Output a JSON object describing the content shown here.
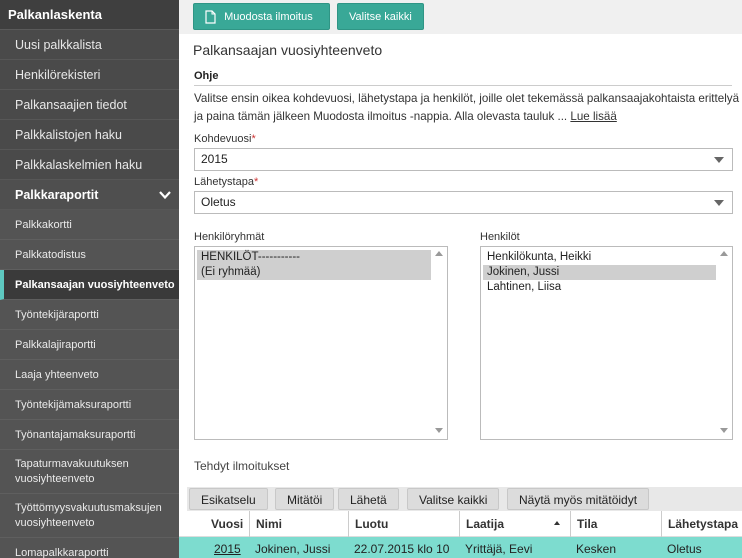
{
  "sidebar": {
    "title": "Palkanlaskenta",
    "items": [
      {
        "label": "Uusi palkkalista"
      },
      {
        "label": "Henkilörekisteri"
      },
      {
        "label": "Palkansaajien tiedot"
      },
      {
        "label": "Palkkalistojen haku"
      },
      {
        "label": "Palkkalaskelmien haku"
      }
    ],
    "section": {
      "label": "Palkkaraportit",
      "expanded_icon": "chevron-down-icon"
    },
    "subitems": [
      {
        "label": "Palkkakortti"
      },
      {
        "label": "Palkkatodistus"
      },
      {
        "label": "Palkansaajan vuosiyhteenveto",
        "active": true
      },
      {
        "label": "Työntekijäraportti"
      },
      {
        "label": "Palkkalajiraportti"
      },
      {
        "label": "Laaja yhteenveto"
      },
      {
        "label": "Työntekijämaksuraportti"
      },
      {
        "label": "Työnantajamaksuraportti"
      },
      {
        "label": "Tapaturmavakuutuksen vuosiyhteenveto"
      },
      {
        "label": "Työttömyysvakuutusmaksujen vuosiyhteenveto"
      },
      {
        "label": "Lomapalkkaraportti"
      }
    ]
  },
  "toolbar": {
    "create_label": "Muodosta ilmoitus",
    "select_all_label": "Valitse kaikki"
  },
  "page": {
    "title": "Palkansaajan vuosiyhteenveto",
    "help_heading": "Ohje",
    "help_text": "Valitse ensin oikea kohdevuosi, lähetystapa ja henkilöt, joille olet tekemässä palkansaajakohtaista erittelyä ja paina tämän jälkeen Muodosta ilmoitus -nappia. Alla olevasta tauluk ...",
    "read_more": "Lue lisää"
  },
  "form": {
    "year_label": "Kohdevuosi",
    "year_value": "2015",
    "method_label": "Lähetystapa",
    "method_value": "Oletus",
    "required_mark": "*",
    "groups_label": "Henkilöryhmät",
    "groups": [
      {
        "label": "HENKILÖT-----------",
        "selected": true
      },
      {
        "label": "(Ei ryhmää)",
        "selected": true
      }
    ],
    "persons_label": "Henkilöt",
    "persons": [
      {
        "label": "Henkilökunta, Heikki",
        "selected": false
      },
      {
        "label": "Jokinen, Jussi",
        "selected": true
      },
      {
        "label": "Lahtinen, Liisa",
        "selected": false
      }
    ]
  },
  "reports": {
    "section_label": "Tehdyt ilmoitukset",
    "buttons": {
      "preview": "Esikatselu",
      "cancel": "Mitätöi",
      "send": "Lähetä",
      "select_all": "Valitse kaikki",
      "show_cancelled": "Näytä myös mitätöidyt"
    },
    "columns": {
      "year": "Vuosi",
      "name": "Nimi",
      "created": "Luotu",
      "author": "Laatija",
      "status": "Tila",
      "method": "Lähetystapa"
    },
    "rows": [
      {
        "year": "2015",
        "name": "Jokinen, Jussi",
        "created": "22.07.2015 klo 10",
        "author": "Yrittäjä, Eevi",
        "status": "Kesken",
        "method": "Oletus"
      }
    ]
  },
  "colors": {
    "accent": "#39a897",
    "selected_row": "#7ddccf",
    "sidebar_bg": "#4a4a4a",
    "active_marker": "#5ec8c0"
  }
}
